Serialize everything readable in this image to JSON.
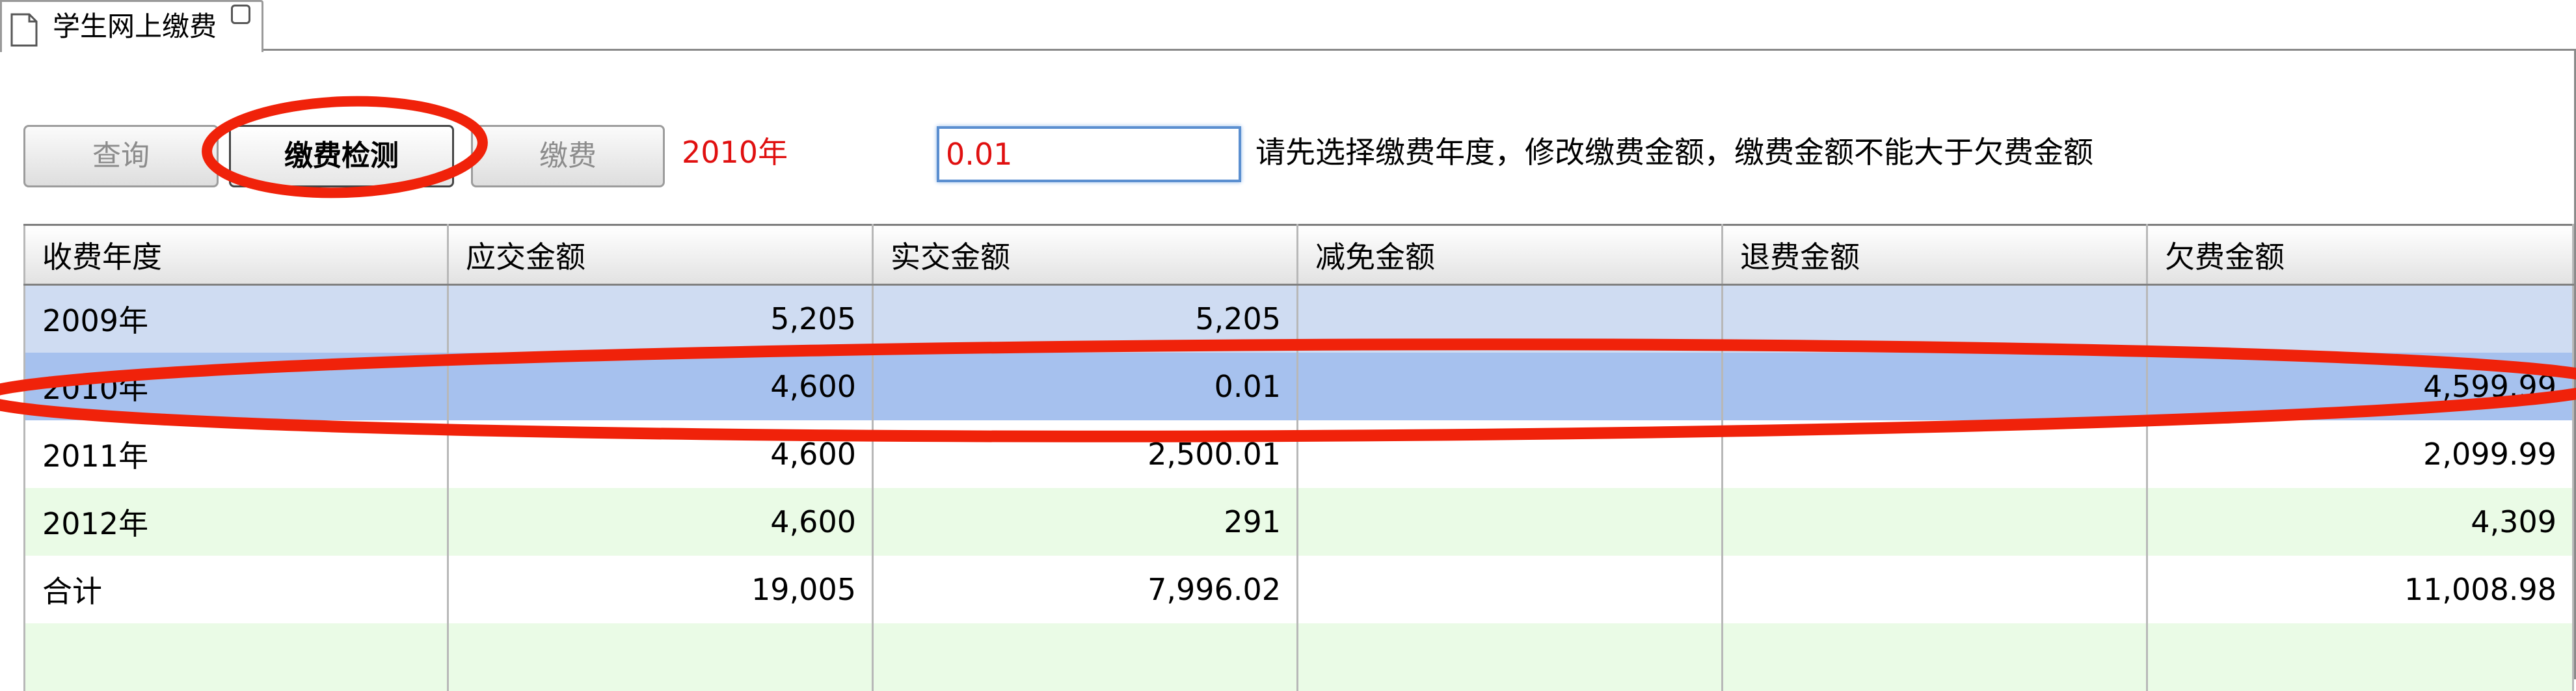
{
  "tab": {
    "label": "学生网上缴费",
    "icon": "document-icon",
    "close_icon": "close-icon"
  },
  "toolbar": {
    "query_label": "查询",
    "check_label": "缴费检测",
    "pay_label": "缴费",
    "year_label": "2010年",
    "amount_value": "0.01",
    "hint": "请先选择缴费年度，修改缴费金额，缴费金额不能大于欠费金额"
  },
  "table": {
    "headers": [
      "收费年度",
      "应交金额",
      "实交金额",
      "减免金额",
      "退费金额",
      "欠费金额"
    ],
    "rows": [
      [
        "2009年",
        "5,205",
        "5,205",
        "",
        "",
        ""
      ],
      [
        "2010年",
        "4,600",
        "0.01",
        "",
        "",
        "4,599.99"
      ],
      [
        "2011年",
        "4,600",
        "2,500.01",
        "",
        "",
        "2,099.99"
      ],
      [
        "2012年",
        "4,600",
        "291",
        "",
        "",
        "4,309"
      ],
      [
        "合计",
        "19,005",
        "7,996.02",
        "",
        "",
        "11,008.98"
      ],
      [
        "",
        "",
        "",
        "",
        "",
        ""
      ]
    ],
    "selected_row": "2010年"
  },
  "colors": {
    "accent_red": "#e01010",
    "selected_row": "#a6c1ee",
    "alt_row": "#cfdcf2",
    "green_row": "#eafbe6"
  }
}
